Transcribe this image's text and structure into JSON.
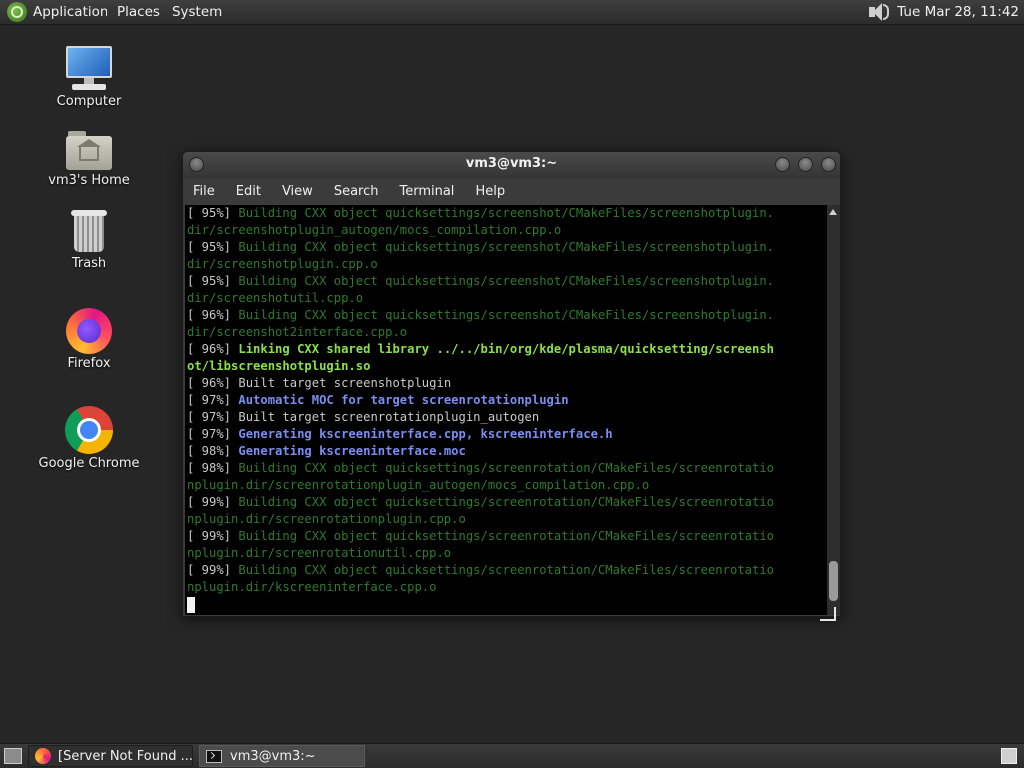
{
  "top_panel": {
    "menus": [
      "Applications",
      "Places",
      "System"
    ],
    "clock": "Tue Mar 28, 11:42",
    "volume_icon": "speaker-icon"
  },
  "desktop_icons": [
    {
      "label": "Computer",
      "icon": "computer-icon"
    },
    {
      "label": "vm3's Home",
      "icon": "home-folder-icon"
    },
    {
      "label": "Trash",
      "icon": "trash-icon"
    },
    {
      "label": "Firefox",
      "icon": "firefox-icon"
    },
    {
      "label": "Google Chrome",
      "icon": "chrome-icon"
    }
  ],
  "terminal": {
    "title": "vm3@vm3:~",
    "menus": [
      "File",
      "Edit",
      "View",
      "Search",
      "Terminal",
      "Help"
    ],
    "lines": [
      {
        "prefix": "[ 95%] ",
        "text": "Building CXX object quicksettings/screenshot/CMakeFiles/screenshotplugin.",
        "style": "green"
      },
      {
        "prefix": "",
        "text": "dir/screenshotplugin_autogen/mocs_compilation.cpp.o",
        "style": "green"
      },
      {
        "prefix": "[ 95%] ",
        "text": "Building CXX object quicksettings/screenshot/CMakeFiles/screenshotplugin.",
        "style": "green"
      },
      {
        "prefix": "",
        "text": "dir/screenshotplugin.cpp.o",
        "style": "green"
      },
      {
        "prefix": "[ 95%] ",
        "text": "Building CXX object quicksettings/screenshot/CMakeFiles/screenshotplugin.",
        "style": "green"
      },
      {
        "prefix": "",
        "text": "dir/screenshotutil.cpp.o",
        "style": "green"
      },
      {
        "prefix": "[ 96%] ",
        "text": "Building CXX object quicksettings/screenshot/CMakeFiles/screenshotplugin.",
        "style": "green"
      },
      {
        "prefix": "",
        "text": "dir/screenshot2interface.cpp.o",
        "style": "green"
      },
      {
        "prefix": "[ 96%] ",
        "text": "Linking CXX shared library ../../bin/org/kde/plasma/quicksetting/screensh",
        "style": "link"
      },
      {
        "prefix": "",
        "text": "ot/libscreenshotplugin.so",
        "style": "link"
      },
      {
        "prefix": "[ 96%] ",
        "text": "Built target screenshotplugin",
        "style": "gray"
      },
      {
        "prefix": "[ 97%] ",
        "text": "Automatic MOC for target screenrotationplugin",
        "style": "blue"
      },
      {
        "prefix": "[ 97%] ",
        "text": "Built target screenrotationplugin_autogen",
        "style": "gray"
      },
      {
        "prefix": "[ 97%] ",
        "text": "Generating kscreeninterface.cpp, kscreeninterface.h",
        "style": "blue"
      },
      {
        "prefix": "[ 98%] ",
        "text": "Generating kscreeninterface.moc",
        "style": "blue"
      },
      {
        "prefix": "[ 98%] ",
        "text": "Building CXX object quicksettings/screenrotation/CMakeFiles/screenrotatio",
        "style": "green"
      },
      {
        "prefix": "",
        "text": "nplugin.dir/screenrotationplugin_autogen/mocs_compilation.cpp.o",
        "style": "green"
      },
      {
        "prefix": "[ 99%] ",
        "text": "Building CXX object quicksettings/screenrotation/CMakeFiles/screenrotatio",
        "style": "green"
      },
      {
        "prefix": "",
        "text": "nplugin.dir/screenrotationplugin.cpp.o",
        "style": "green"
      },
      {
        "prefix": "[ 99%] ",
        "text": "Building CXX object quicksettings/screenrotation/CMakeFiles/screenrotatio",
        "style": "green"
      },
      {
        "prefix": "",
        "text": "nplugin.dir/screenrotationutil.cpp.o",
        "style": "green"
      },
      {
        "prefix": "[ 99%] ",
        "text": "Building CXX object quicksettings/screenrotation/CMakeFiles/screenrotatio",
        "style": "green"
      },
      {
        "prefix": "",
        "text": "nplugin.dir/kscreeninterface.cpp.o",
        "style": "green"
      }
    ]
  },
  "taskbar": {
    "tasks": [
      {
        "label": "[Server Not Found ...",
        "icon": "firefox-icon"
      },
      {
        "label": "vm3@vm3:~",
        "icon": "terminal-icon"
      }
    ]
  }
}
